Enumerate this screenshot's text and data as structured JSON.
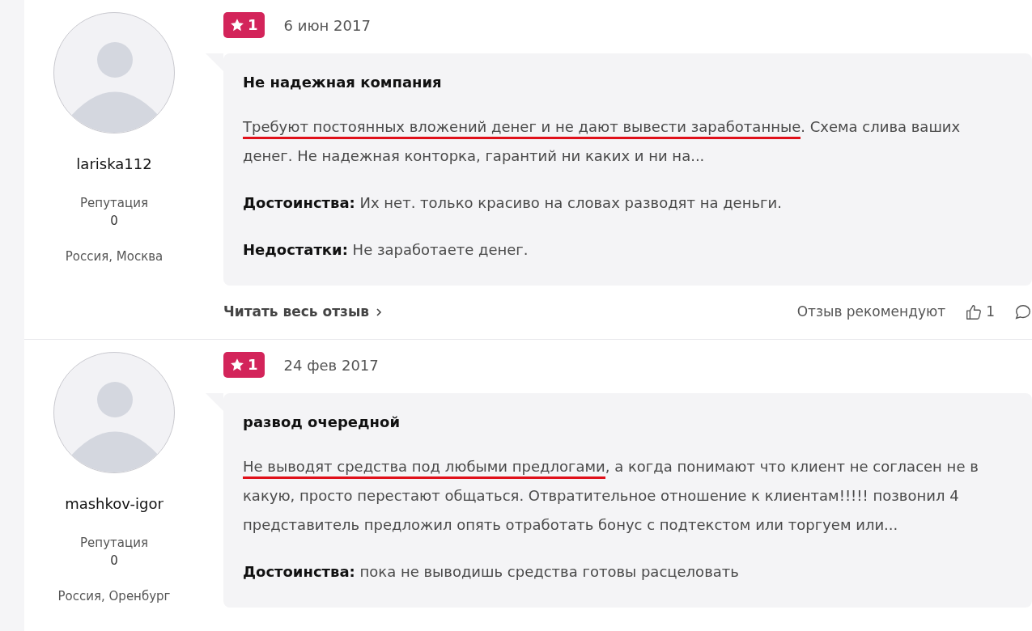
{
  "reviews": [
    {
      "user": {
        "name": "lariska112",
        "reputation_label": "Репутация",
        "reputation": "0",
        "location": "Россия, Москва"
      },
      "rating": "1",
      "date": "6 июн 2017",
      "title": "Не надежная компания",
      "text": [
        {
          "text": "Требуют постоянных вложений денег и не дают вывести заработанные",
          "underlined": true
        },
        {
          "text": ". Схема слива ваших денег. Не надежная конторка, гарантий ни каких и ни на...",
          "underlined": false
        }
      ],
      "pros_label": "Достоинства:",
      "pros": "Их нет. только красиво на словах разводят на деньги.",
      "cons_label": "Недостатки:",
      "cons": "Не заработаете денег.",
      "read_more": "Читать весь отзыв",
      "recommend_label": "Отзыв рекомендуют",
      "likes": "1"
    },
    {
      "user": {
        "name": "mashkov-igor",
        "reputation_label": "Репутация",
        "reputation": "0",
        "location": "Россия, Оренбург"
      },
      "rating": "1",
      "date": "24 фев 2017",
      "title": "развод очередной",
      "text": [
        {
          "text": "Не выводят средства под любыми предлогами",
          "underlined": true
        },
        {
          "text": ", а когда понимают что клиент не согласен не в какую, просто перестают общаться. Отвратительное отношение к клиентам!!!!! позвонил 4 представитель предложил опять отработать бонус с подтекстом или торгуем или...",
          "underlined": false
        }
      ],
      "pros_label": "Достоинства:",
      "pros": "пока не выводишь средства готовы расцеловать"
    }
  ]
}
